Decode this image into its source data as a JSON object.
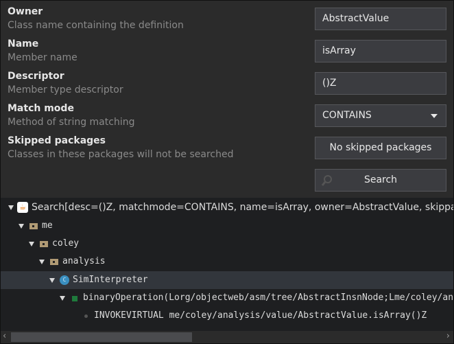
{
  "form": {
    "owner": {
      "title": "Owner",
      "desc": "Class name containing the definition",
      "value": "AbstractValue"
    },
    "name": {
      "title": "Name",
      "desc": "Member name",
      "value": "isArray"
    },
    "descriptor": {
      "title": "Descriptor",
      "desc": "Member type descriptor",
      "value": "()Z"
    },
    "match_mode": {
      "title": "Match mode",
      "desc": "Method of string matching",
      "value": "CONTAINS"
    },
    "skipped": {
      "title": "Skipped packages",
      "desc": "Classes in these packages will not be searched",
      "button": "No skipped packages"
    },
    "search_button": "Search"
  },
  "tree": {
    "root": "Search[desc=()Z, matchmode=CONTAINS, name=isArray, owner=AbstractValue, skippackages=[]]",
    "nodes": [
      "me",
      "coley",
      "analysis",
      "SimInterpreter",
      "binaryOperation(Lorg/objectweb/asm/tree/AbstractInsnNode;Lme/coley/analysis/value/AbstractValue;Lme/coley/analysis/value/AbstractValue;)Lme/coley/analysis/value/AbstractValue;",
      "INVOKEVIRTUAL me/coley/analysis/value/AbstractValue.isArray()Z"
    ]
  },
  "colors": {
    "package": "#b09a74",
    "class": "#3a8fc0",
    "method": "#1f7a3c"
  }
}
